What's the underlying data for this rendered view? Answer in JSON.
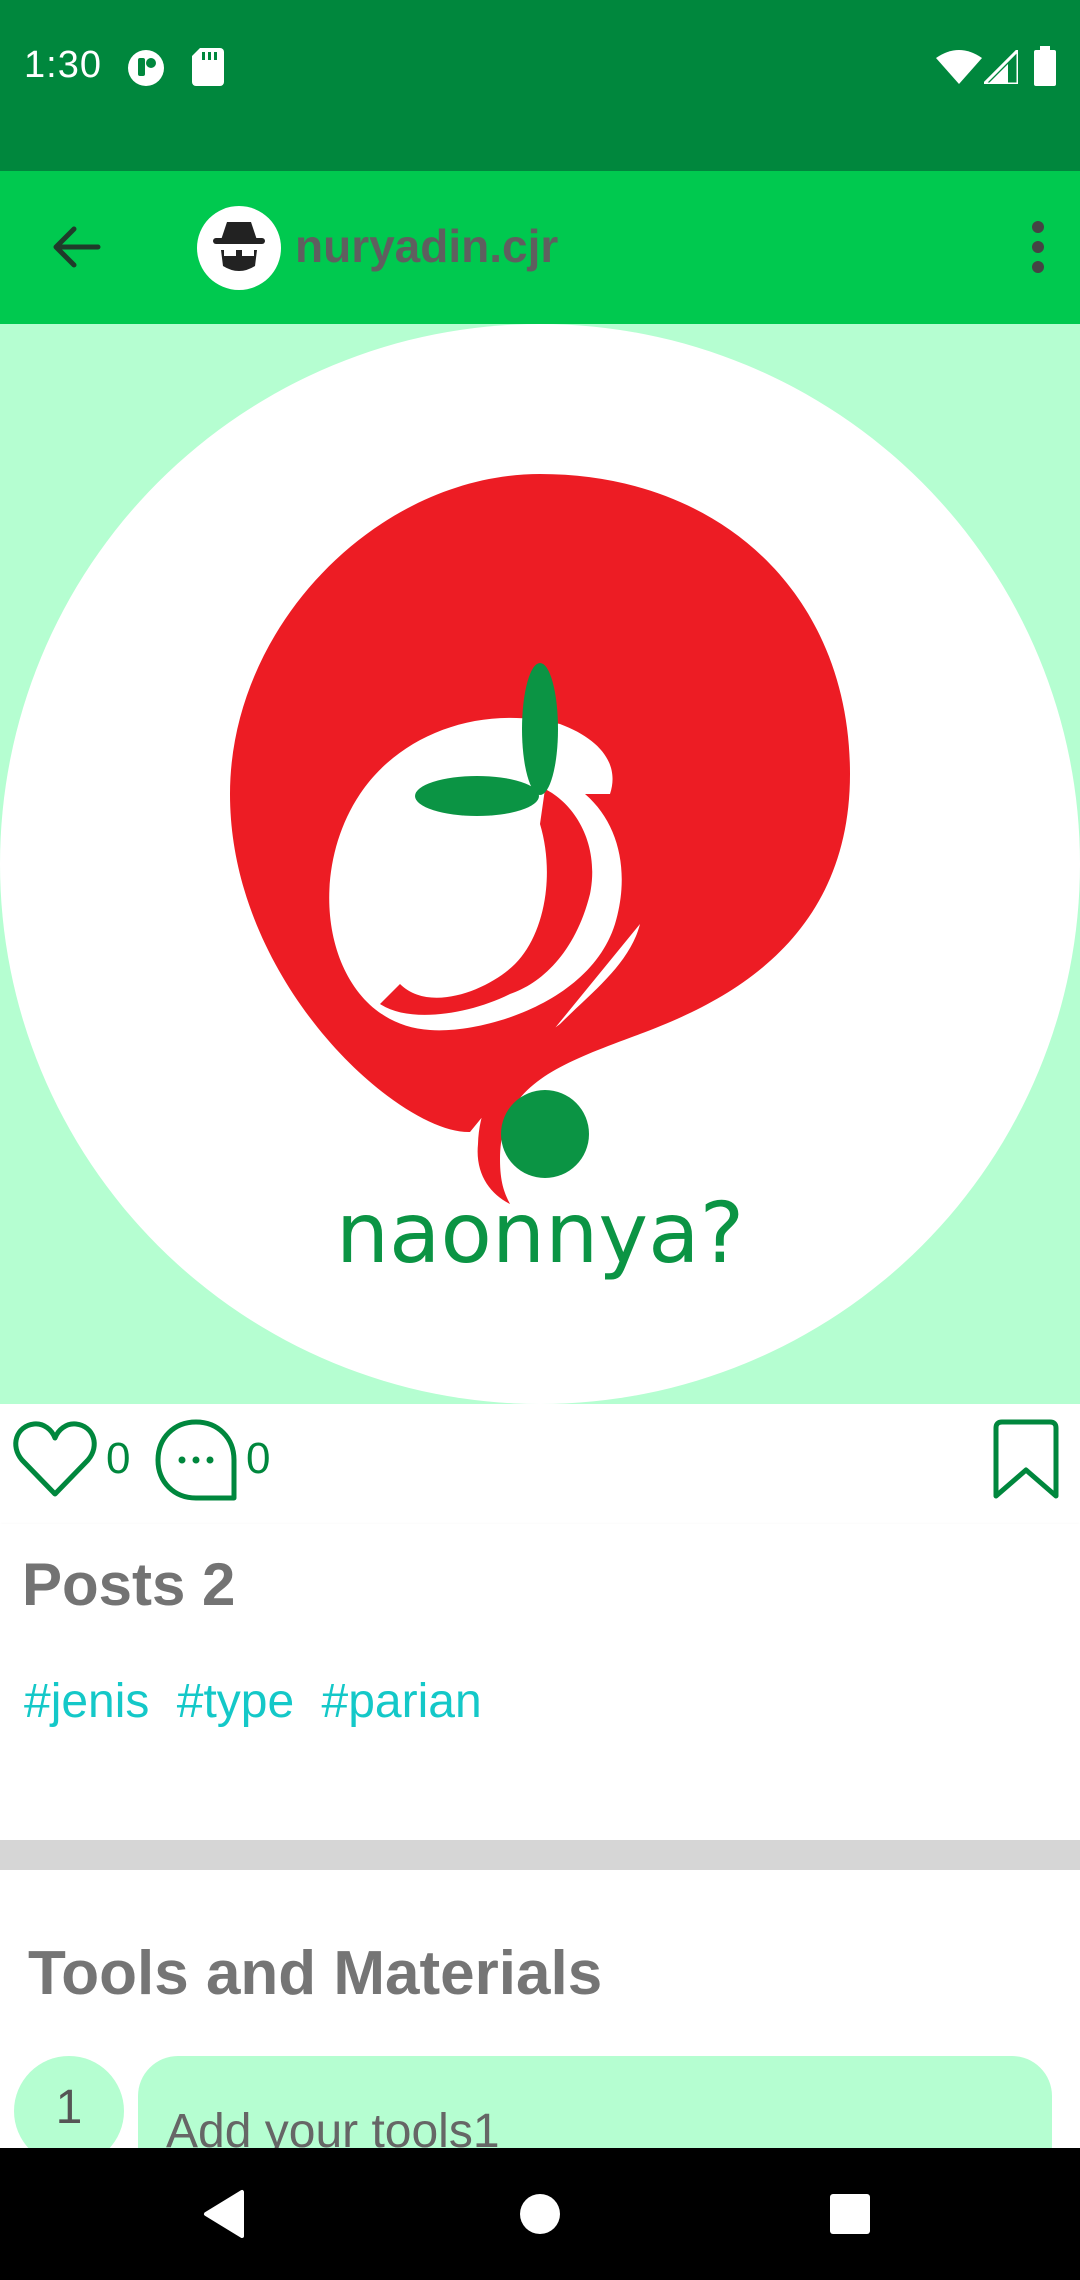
{
  "status_bar": {
    "time": "1:30",
    "icons": [
      "notification-icon",
      "sd-card-icon",
      "wifi-icon",
      "cell-signal-icon",
      "battery-icon"
    ]
  },
  "app_bar": {
    "username": "nuryadin.cjr",
    "back_icon": "arrow-back-icon",
    "menu_icon": "more-vert-icon"
  },
  "post_image": {
    "logo_text": "naonnya?"
  },
  "actions": {
    "likes": "0",
    "comments": "0"
  },
  "post": {
    "title": "Posts 2",
    "tags": [
      "#jenis",
      "#type",
      "#parian"
    ]
  },
  "tools": {
    "title": "Tools and Materials",
    "items": [
      {
        "number": "1",
        "placeholder": "Add your tools1"
      }
    ]
  },
  "nav_bar": {
    "buttons": [
      "back-triangle-icon",
      "home-circle-icon",
      "recents-square-icon"
    ]
  },
  "colors": {
    "status_bar": "#00873d",
    "app_bar": "#00c94f",
    "mint": "#b5fed1",
    "accent_green": "#00873d",
    "tag_color": "#14c8c8",
    "logo_red": "#ed1c24",
    "logo_green": "#0b9444"
  }
}
